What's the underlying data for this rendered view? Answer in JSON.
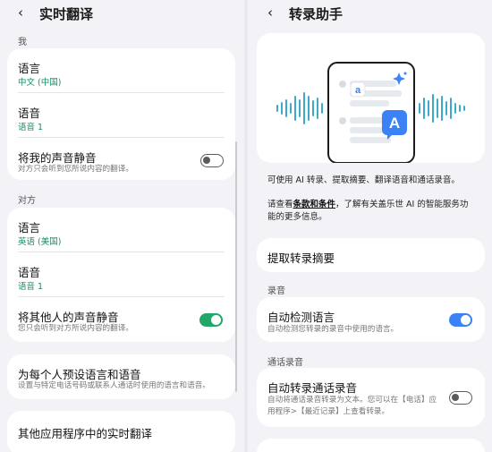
{
  "left": {
    "title": "实时翻译",
    "section_me": "我",
    "me": {
      "language_label": "语言",
      "language_value": "中文 (中国)",
      "voice_label": "语音",
      "voice_value": "语音 1",
      "mute_label": "将我的声音静音",
      "mute_desc": "对方只会听到您所说内容的翻译。",
      "mute_on": false
    },
    "section_other": "对方",
    "other": {
      "language_label": "语言",
      "language_value": "英语 (美国)",
      "voice_label": "语音",
      "voice_value": "语音 1",
      "mute_label": "将其他人的声音静音",
      "mute_desc": "您只会听到对方所说内容的翻译。",
      "mute_on": true
    },
    "preset": {
      "label": "为每个人预设语言和语音",
      "desc": "设置与特定电话号码或联系人通话时使用的语言和语音。"
    },
    "other_apps": "其他应用程序中的实时翻译"
  },
  "right": {
    "title": "转录助手",
    "intro1": "可使用 AI 转录、提取摘要、翻译语音和通话录音。",
    "intro2_pre": "请查看",
    "intro2_link": "条款和条件",
    "intro2_post": "，了解有关盖乐世 AI 的智能服务功",
    "intro2_line2": "能的更多信息。",
    "summary_btn": "提取转录摘要",
    "section_recording": "录音",
    "auto_detect": {
      "label": "自动检测语言",
      "desc": "自动检测您转录的录音中使用的语言。",
      "on": true
    },
    "section_call": "通话录音",
    "auto_transcribe": {
      "label": "自动转录通话录音",
      "desc1": "自动将通话录音转录为文本。您可以在【电话】应",
      "desc2": "用程序>【最近记录】上查看转录。",
      "on": false
    },
    "illustration": {
      "letter_small": "a",
      "letter_big": "A"
    }
  },
  "colors": {
    "green": "#20a769",
    "blue": "#3b82f6",
    "accent_green_text": "#1a8c63"
  }
}
